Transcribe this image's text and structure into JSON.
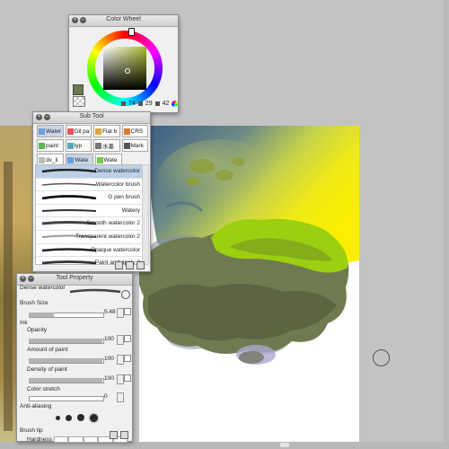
{
  "color_wheel": {
    "title": "Color Wheel",
    "values": [
      "74",
      "29",
      "42"
    ],
    "accent_color": "#6a7a4b"
  },
  "subtool": {
    "title": "Sub Tool",
    "tab_rows": [
      [
        "Water",
        "Oil pa",
        "Flat b",
        "CRS"
      ],
      [
        "paint",
        "typ",
        "水墨",
        "Mark"
      ],
      [
        "dv_li",
        "Wate",
        "Wate"
      ]
    ],
    "brushes": [
      "Dense watercolor",
      "Watercolor brush",
      "G pen brush",
      "Watery",
      "Smooth watercolor 2",
      "Transparent watercolor 2",
      "Opaque watercolor",
      "Paint and apply 2"
    ]
  },
  "tool_property": {
    "title": "Tool Property",
    "header": "Dense watercolor",
    "brush_size_label": "Brush Size",
    "brush_size_value": "5.48",
    "ink_label": "Ink",
    "rows": [
      {
        "label": "Opacity",
        "value": "100",
        "fill": 1.0
      },
      {
        "label": "Amount of paint",
        "value": "100",
        "fill": 1.0
      },
      {
        "label": "Density of paint",
        "value": "100",
        "fill": 1.0
      },
      {
        "label": "Color stretch",
        "value": "0",
        "fill": 0.0
      }
    ],
    "anti_alias_label": "Anti-aliasing",
    "brush_tip_label": "Brush tip",
    "hardness_label": "Hardness"
  }
}
